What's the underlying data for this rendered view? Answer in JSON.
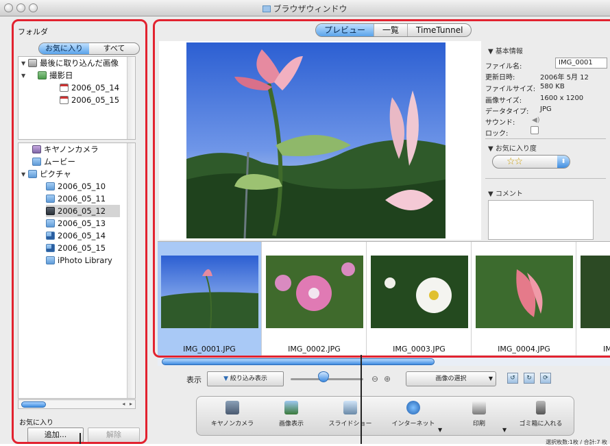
{
  "window": {
    "title": "ブラウザウィンドウ"
  },
  "sidebar": {
    "folder_label": "フォルダ",
    "segments": [
      "お気に入り",
      "すべて"
    ],
    "tree_top": [
      {
        "label": "最後に取り込んだ画像",
        "icon": "imported-images-icon"
      },
      {
        "label": "撮影日",
        "icon": "shooting-date-icon"
      },
      {
        "label": "2006_05_14",
        "icon": "calendar-icon"
      },
      {
        "label": "2006_05_15",
        "icon": "calendar-icon"
      }
    ],
    "tree_bottom": [
      {
        "label": "キヤノンカメラ",
        "icon": "camera-folder-icon"
      },
      {
        "label": "ムービー",
        "icon": "movie-folder-icon"
      },
      {
        "label": "ピクチャ",
        "icon": "pictures-folder-icon"
      },
      {
        "label": "2006_05_10",
        "icon": "folder-icon"
      },
      {
        "label": "2006_05_11",
        "icon": "folder-icon"
      },
      {
        "label": "2006_05_12",
        "icon": "folder-icon"
      },
      {
        "label": "2006_05_13",
        "icon": "folder-icon"
      },
      {
        "label": "2006_05_14",
        "icon": "download-folder-icon"
      },
      {
        "label": "2006_05_15",
        "icon": "download-folder-icon"
      },
      {
        "label": "iPhoto Library",
        "icon": "iphoto-library-icon"
      }
    ],
    "favorites_label": "お気に入り",
    "add_button": "追加...",
    "remove_button": "解除"
  },
  "tabs": [
    "プレビュー",
    "一覧",
    "TimeTunnel"
  ],
  "info": {
    "basic_header": "▼ 基本情報",
    "fields": [
      {
        "key": "ファイル名:",
        "value": "IMG_0001"
      },
      {
        "key": "更新日時:",
        "value": "2006年 5月 12"
      },
      {
        "key": "ファイルサイズ:",
        "value": "580 KB"
      },
      {
        "key": "画像サイズ:",
        "value": "1600 x 1200"
      },
      {
        "key": "データタイプ:",
        "value": "JPG"
      },
      {
        "key": "サウンド:",
        "value": ""
      },
      {
        "key": "ロック:",
        "value": ""
      }
    ],
    "favorite_header": "▼ お気に入り度",
    "stars": "☆☆",
    "comment_header": "▼ コメント"
  },
  "thumbnails": [
    "IMG_0001.JPG",
    "IMG_0002.JPG",
    "IMG_0003.JPG",
    "IMG_0004.JPG",
    "IM"
  ],
  "controls": {
    "display_label": "表示",
    "filter_button": "絞り込み表示",
    "select_popup": "画像の選択"
  },
  "toolbar": [
    {
      "label": "キヤノンカメラ",
      "icon": "camera-icon"
    },
    {
      "label": "画像表示",
      "icon": "image-view-icon"
    },
    {
      "label": "スライドショー",
      "icon": "slideshow-icon"
    },
    {
      "label": "インターネット",
      "icon": "internet-icon"
    },
    {
      "label": "印刷",
      "icon": "print-icon"
    },
    {
      "label": "ゴミ箱に入れる",
      "icon": "trash-icon"
    }
  ],
  "status": "選択枚数:1枚 / 合計:7 枚"
}
